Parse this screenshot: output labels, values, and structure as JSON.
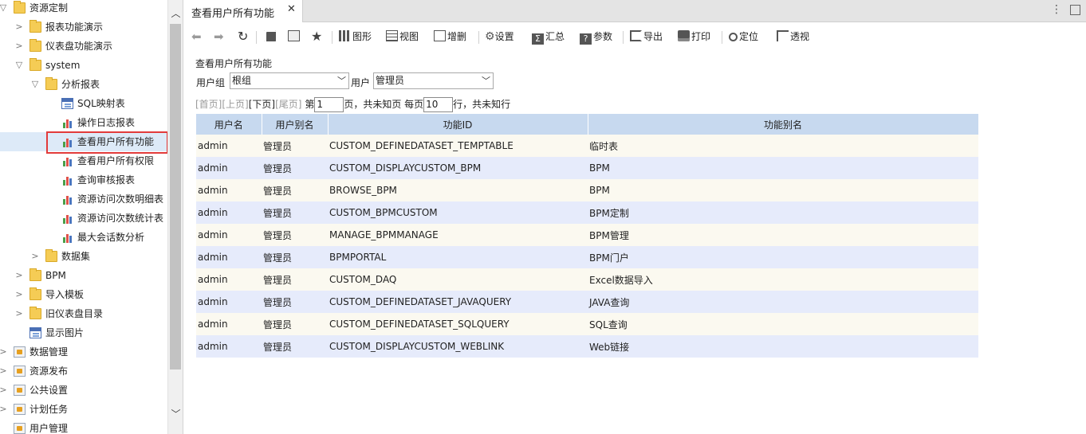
{
  "tree": {
    "nodes": [
      {
        "label": "资源定制",
        "icon": "folder-icon",
        "arrow": "▽"
      },
      {
        "label": "报表功能演示",
        "icon": "folder-icon",
        "arrow": ">"
      },
      {
        "label": "仪表盘功能演示",
        "icon": "folder-icon",
        "arrow": ">"
      },
      {
        "label": "system",
        "icon": "folder-icon",
        "arrow": "▽"
      },
      {
        "label": "分析报表",
        "icon": "folder-icon",
        "arrow": "▽"
      },
      {
        "label": "SQL映射表",
        "icon": "sql-report-icon",
        "arrow": ""
      },
      {
        "label": "操作日志报表",
        "icon": "chart-report-icon",
        "arrow": ""
      },
      {
        "label": "查看用户所有功能",
        "icon": "chart-report-icon",
        "arrow": ""
      },
      {
        "label": "查看用户所有权限",
        "icon": "chart-report-icon",
        "arrow": ""
      },
      {
        "label": "查询审核报表",
        "icon": "chart-report-icon",
        "arrow": ""
      },
      {
        "label": "资源访问次数明细表",
        "icon": "chart-report-icon",
        "arrow": ""
      },
      {
        "label": "资源访问次数统计表",
        "icon": "chart-report-icon",
        "arrow": ""
      },
      {
        "label": "最大会话数分析",
        "icon": "chart-report-icon",
        "arrow": ""
      },
      {
        "label": "数据集",
        "icon": "folder-icon",
        "arrow": ">"
      },
      {
        "label": "BPM",
        "icon": "folder-icon",
        "arrow": ">"
      },
      {
        "label": "导入模板",
        "icon": "folder-icon",
        "arrow": ">"
      },
      {
        "label": "旧仪表盘目录",
        "icon": "folder-icon",
        "arrow": ">"
      },
      {
        "label": "显示图片",
        "icon": "sql-report-icon",
        "arrow": ""
      },
      {
        "label": "数据管理",
        "icon": "data-management-icon",
        "arrow": ">"
      },
      {
        "label": "资源发布",
        "icon": "publish-icon",
        "arrow": ">"
      },
      {
        "label": "公共设置",
        "icon": "settings-icon",
        "arrow": ">"
      },
      {
        "label": "计划任务",
        "icon": "schedule-icon",
        "arrow": ">"
      },
      {
        "label": "用户管理",
        "icon": "user-management-icon",
        "arrow": ""
      }
    ],
    "scroll_up": "︿",
    "scroll_down": "﹀"
  },
  "tab": {
    "title": "查看用户所有功能",
    "close": "✕"
  },
  "tabbar": {
    "menu": "⋮"
  },
  "toolbar": {
    "back": "⬅",
    "forward": "➡",
    "refresh": "↻",
    "chart": "图形",
    "view": "视图",
    "add_delete": "增删",
    "settings": "设置",
    "summary": "汇总",
    "params": "参数",
    "export": "导出",
    "print": "打印",
    "locate": "定位",
    "pivot": "透视"
  },
  "report": {
    "title": "查看用户所有功能",
    "group_label": "用户组",
    "group_value": "根组",
    "user_label": "用户",
    "user_value": "管理员",
    "pager": {
      "first": "[首页]",
      "prev": "[上页]",
      "next": "[下页]",
      "last": "[尾页]",
      "page_prefix": "第",
      "page_value": "1",
      "page_suffix": "页，共未知页 每页",
      "per_page_value": "10",
      "rows_suffix": "行，共未知行"
    },
    "columns": [
      "用户名",
      "用户别名",
      "功能ID",
      "功能别名"
    ],
    "rows": [
      [
        "admin",
        "管理员",
        "CUSTOM_DEFINEDATASET_TEMPTABLE",
        "临时表"
      ],
      [
        "admin",
        "管理员",
        "CUSTOM_DISPLAYCUSTOM_BPM",
        "BPM"
      ],
      [
        "admin",
        "管理员",
        "BROWSE_BPM",
        "BPM"
      ],
      [
        "admin",
        "管理员",
        "CUSTOM_BPMCUSTOM",
        "BPM定制"
      ],
      [
        "admin",
        "管理员",
        "MANAGE_BPMMANAGE",
        "BPM管理"
      ],
      [
        "admin",
        "管理员",
        "BPMPORTAL",
        "BPM门户"
      ],
      [
        "admin",
        "管理员",
        "CUSTOM_DAQ",
        "Excel数据导入"
      ],
      [
        "admin",
        "管理员",
        "CUSTOM_DEFINEDATASET_JAVAQUERY",
        "JAVA查询"
      ],
      [
        "admin",
        "管理员",
        "CUSTOM_DEFINEDATASET_SQLQUERY",
        "SQL查询"
      ],
      [
        "admin",
        "管理员",
        "CUSTOM_DISPLAYCUSTOM_WEBLINK",
        "Web链接"
      ]
    ]
  },
  "colors": {
    "selection_border": "#e23b3b",
    "header_bg": "#c7d9ef",
    "row_even": "#e6ebfb",
    "row_odd": "#fbf9f0"
  }
}
